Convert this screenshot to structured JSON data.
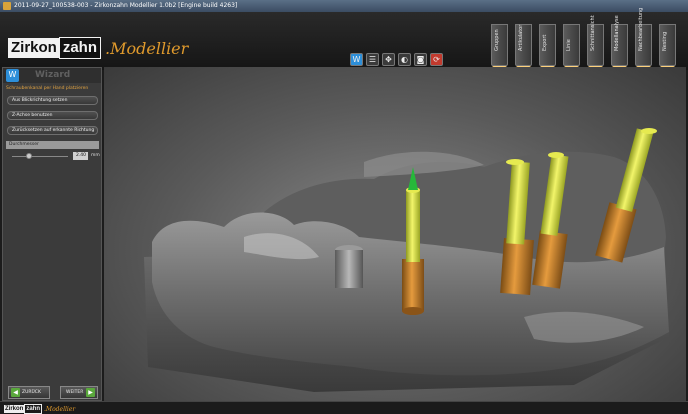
{
  "window": {
    "title": "2011-09-27_100538-003 - Zirkonzahn Modellier 1.0b2 [Engine build 4263]"
  },
  "logo": {
    "part1": "Zirkon",
    "part2": "zahn",
    "product": ".Modellier"
  },
  "stages": [
    {
      "label": "Gruppen",
      "icon": "group-icon"
    },
    {
      "label": "Artikulator",
      "icon": "articulator-icon"
    },
    {
      "label": "Export",
      "icon": "export-icon"
    },
    {
      "label": "Linie",
      "icon": "line-icon"
    },
    {
      "label": "Schnittansicht",
      "icon": "section-icon"
    },
    {
      "label": "Modellanalyse",
      "icon": "analysis-icon"
    },
    {
      "label": "Nachbearbeitung",
      "icon": "postprocess-icon"
    },
    {
      "label": "Nesting",
      "icon": "nesting-icon"
    }
  ],
  "toolbar": [
    "wizard-icon",
    "list-icon",
    "move-icon",
    "view-icon",
    "camera-icon",
    "reset-icon"
  ],
  "wizard": {
    "title": "Wizard",
    "subtitle": "Schraubenkanal per Hand platzieren",
    "buttons": [
      "Aus Blickrichtung setzen",
      "Z-Achse benutzen",
      "Zurücksetzen auf erkannte Richtung"
    ],
    "param_label": "Durchmesser",
    "diameter_value": "2.40",
    "diameter_unit": "mm",
    "slider_fraction": 0.3,
    "back_label": "ZURÜCK",
    "next_label": "WEITER"
  },
  "colors": {
    "accent": "#e69a25",
    "wizard_blue": "#2d8fd9",
    "nav_green": "#5aa83c",
    "subtitle": "#e2a341"
  },
  "footer": {
    "part1": "Zirkon",
    "part2": "zahn",
    "product": ".Modellier"
  }
}
